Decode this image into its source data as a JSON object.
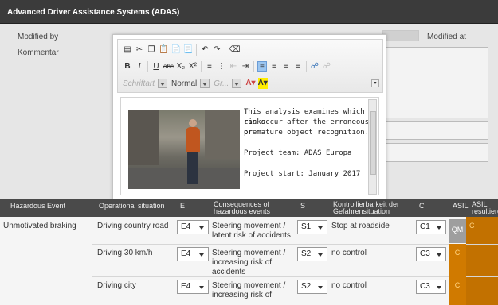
{
  "window": {
    "title": "Advanced Driver Assistance Systems (ADAS)"
  },
  "form": {
    "modified_by_label": "Modified by",
    "modified_at_label": "Modified at",
    "comment_label": "Kommentar"
  },
  "editor": {
    "toolbar": {
      "bold": "B",
      "italic": "I",
      "underline": "U",
      "strike": "abc",
      "subscript": "X₂",
      "superscript": "X²",
      "font_placeholder": "Schriftart",
      "format_value": "Normal",
      "size_placeholder": "Gr..."
    },
    "content": {
      "paragraph1_line1": "This analysis examines which risks",
      "paragraph1_line2": "can occur after the erroneous or",
      "paragraph1_line3": "premature object recognition.",
      "paragraph2": "Project team: ADAS Europa",
      "paragraph3": "Project start: January 2017"
    }
  },
  "table": {
    "columns": [
      "Hazardous Event",
      "Operational situation",
      "E",
      "Consequences of hazardous events",
      "S",
      "Kontrollierbarkeit der Gefahrensituation",
      "C",
      "ASIL",
      "ASIL resultiere"
    ],
    "hazard": "Unmotivated braking",
    "rows": [
      {
        "situation": "Driving country road",
        "e": "E4",
        "consequence": "Steering movement / latent risk of accidents",
        "s": "S1",
        "control": "Stop at roadside",
        "c": "C1",
        "asil": "QM",
        "asil_result": "C"
      },
      {
        "situation": "Driving 30 km/h",
        "e": "E4",
        "consequence": "Steering movement / increasing risk of accidents",
        "s": "S2",
        "control": "no control",
        "c": "C3",
        "asil": "C",
        "asil_result": ""
      },
      {
        "situation": "Driving city",
        "e": "E4",
        "consequence": "Steering movement / increasing risk of",
        "s": "S2",
        "control": "no control",
        "c": "C3",
        "asil": "C",
        "asil_result": ""
      }
    ]
  },
  "colors": {
    "header_bg": "#4a4a4a",
    "asil_c": "#d07a00",
    "asil_qm": "#9e9e9e"
  }
}
